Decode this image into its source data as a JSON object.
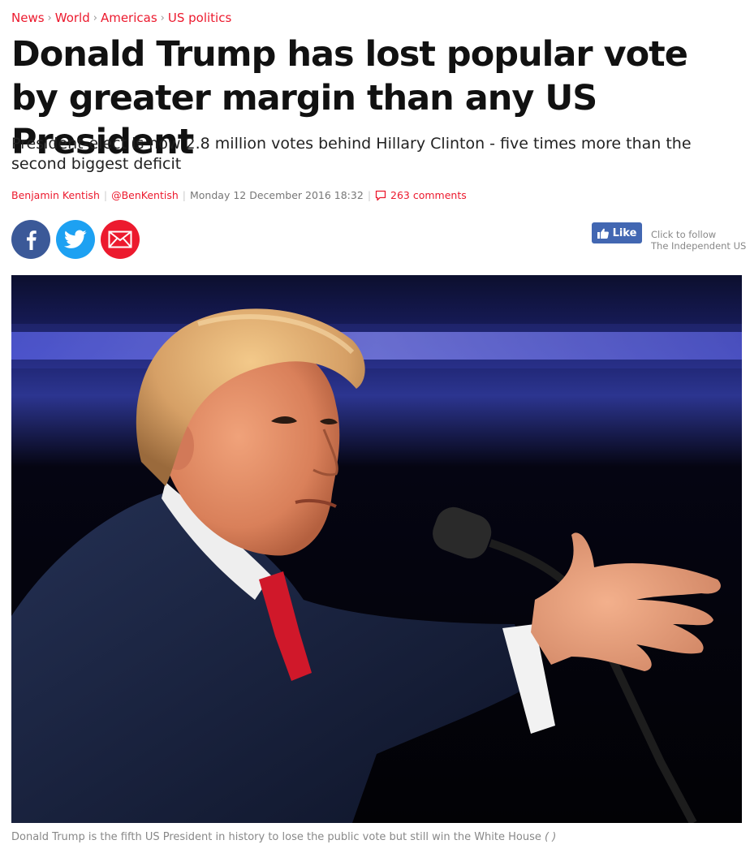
{
  "breadcrumb": {
    "items": [
      "News",
      "World",
      "Americas",
      "US politics"
    ],
    "separator": "›"
  },
  "article": {
    "headline": "Donald Trump has lost popular vote by greater margin than any US President",
    "standfirst": "President-elect is now 2.8 million votes behind Hillary Clinton - five times more than the second biggest deficit"
  },
  "byline": {
    "author": "Benjamin Kentish",
    "twitter": "@BenKentish",
    "date": "Monday 12 December 2016 18:32",
    "comments": "263 comments"
  },
  "share": {
    "facebook_icon": "facebook-icon",
    "twitter_icon": "twitter-icon",
    "email_icon": "email-icon",
    "colors": {
      "facebook": "#3b5998",
      "twitter": "#1da1f2",
      "email": "#ec1a2e"
    }
  },
  "follow": {
    "like_label": "Like",
    "line1": "Click to follow",
    "line2": "The Independent US"
  },
  "image": {
    "caption": "Donald Trump is the fifth US President in history to lose the public vote but still win the White House",
    "credit": "( )"
  },
  "theme": {
    "accent": "#ec1a2e",
    "facebook_like": "#4267b2"
  }
}
